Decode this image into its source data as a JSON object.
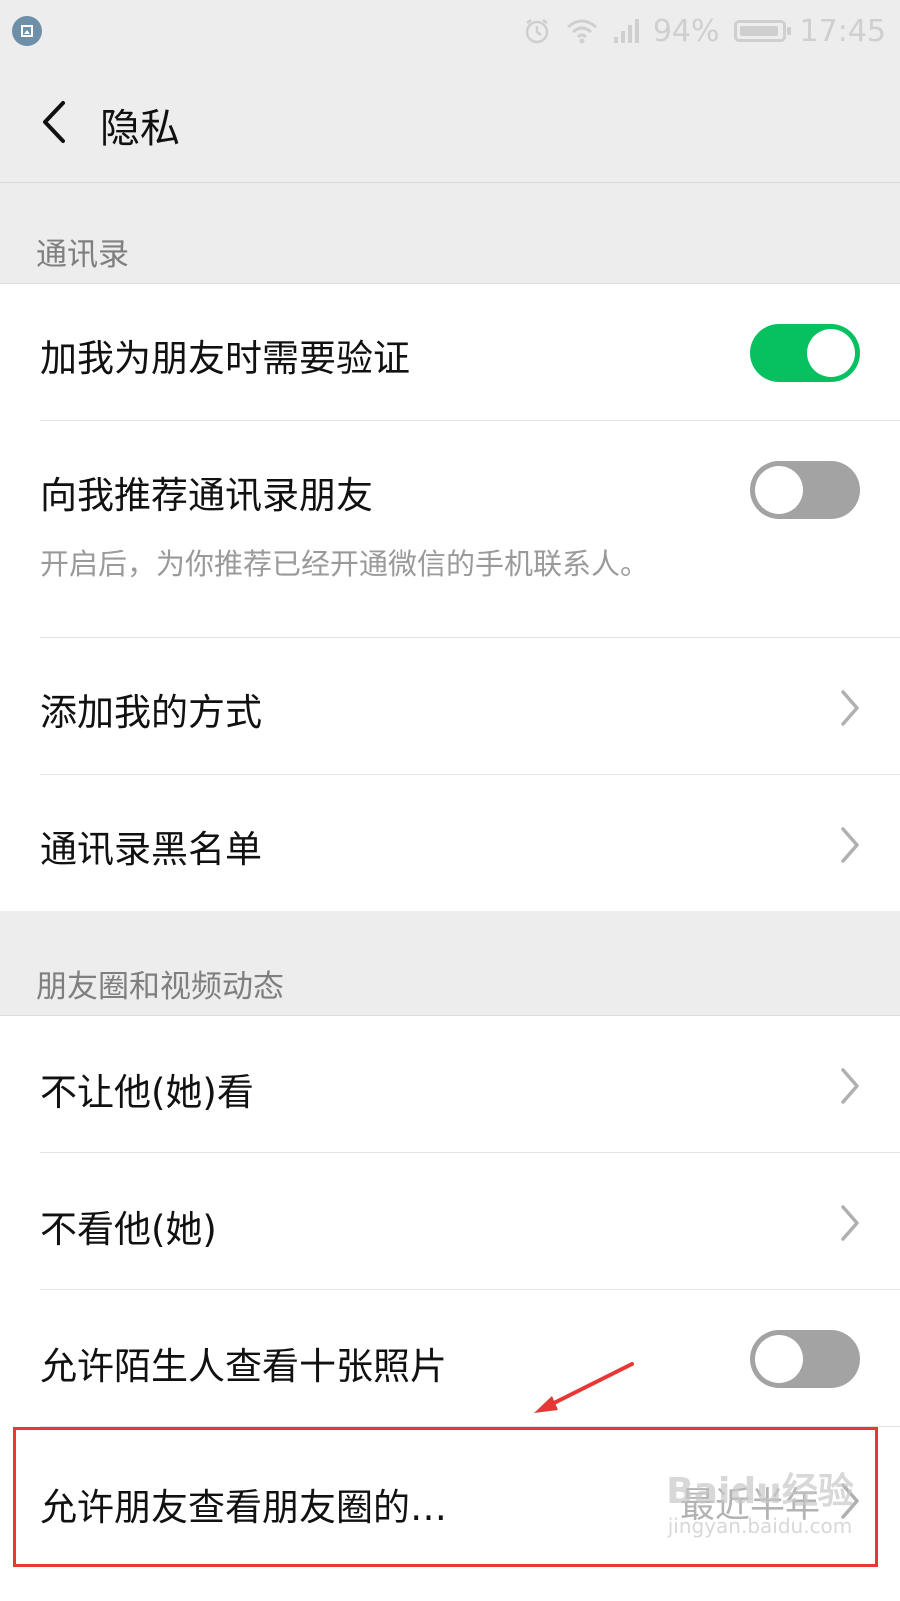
{
  "status_bar": {
    "battery": "94%",
    "battery_level": 0.94,
    "time": "17:45"
  },
  "nav": {
    "title": "隐私"
  },
  "sections": {
    "contacts": {
      "header": "通讯录",
      "rows": {
        "verify": {
          "label": "加我为朋友时需要验证",
          "toggle": true
        },
        "recommend": {
          "label": "向我推荐通讯录朋友",
          "desc": "开启后，为你推荐已经开通微信的手机联系人。",
          "toggle": false
        },
        "add_methods": {
          "label": "添加我的方式"
        },
        "blacklist": {
          "label": "通讯录黑名单"
        }
      }
    },
    "moments": {
      "header": "朋友圈和视频动态",
      "rows": {
        "dont_let_see": {
          "label": "不让他(她)看"
        },
        "dont_see": {
          "label": "不看他(她)"
        },
        "strangers_ten": {
          "label": "允许陌生人查看十张照片",
          "toggle": false
        },
        "allow_range": {
          "label": "允许朋友查看朋友圈的…",
          "value": "最近半年"
        }
      }
    }
  },
  "watermark": {
    "brand": "Baidu经验",
    "url": "jingyan.baidu.com"
  },
  "colors": {
    "toggle_on": "#07c160",
    "toggle_off": "#a3a3a3",
    "annotation": "#e53935"
  }
}
